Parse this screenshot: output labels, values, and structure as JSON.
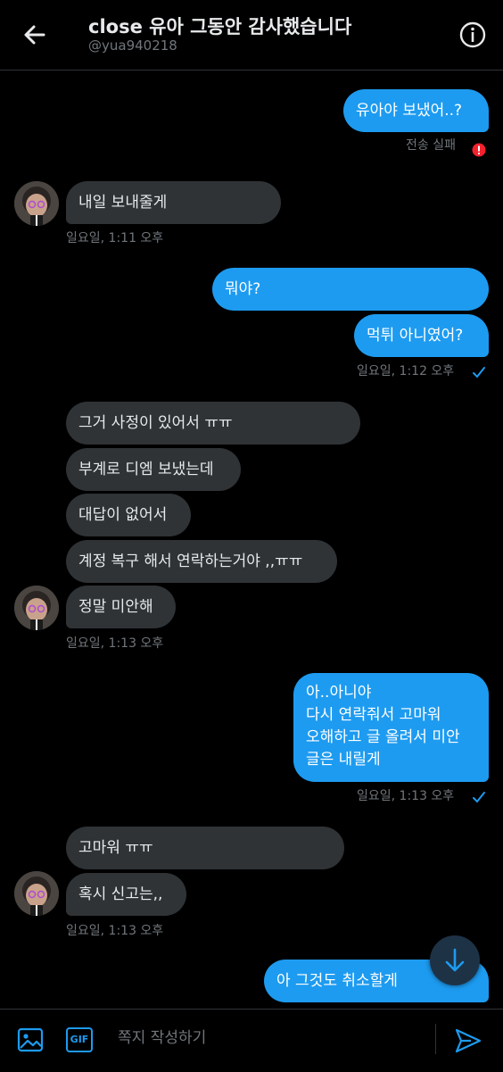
{
  "header": {
    "title": "close 유아 그동안 감사했습니다",
    "handle": "@yua940218"
  },
  "messages": {
    "m1": "유아야 보냈어..?",
    "m1_status": "전송 실패",
    "m2": "내일 보내줄게",
    "m2_time": "일요일, 1:11 오후",
    "m3": "뭐야?",
    "m4": "먹튀 아니였어?",
    "m4_time": "일요일, 1:12 오후",
    "m5": "그거 사정이 있어서 ㅠㅠ",
    "m6": "부계로 디엠 보냈는데",
    "m7": "대답이 없어서",
    "m8": "계정 복구 해서 연락하는거야 ,,ㅠㅠ",
    "m9": "정말 미안해",
    "m9_time": "일요일, 1:13 오후",
    "m10": "아..아니야\n다시 연락줘서 고마워\n오해하고 글 올려서 미안\n글은 내릴게",
    "m10_time": "일요일, 1:13 오후",
    "m11": "고마워 ㅠㅠ",
    "m12": "혹시 신고는,,",
    "m12_time": "일요일, 1:13 오후",
    "m13": "아 그것도 취소할게"
  },
  "composer": {
    "placeholder": "쪽지 작성하기",
    "gif_label": "GIF"
  },
  "colors": {
    "accent": "#1d9bf0",
    "incoming": "#2f3336",
    "error": "#f4212e"
  }
}
